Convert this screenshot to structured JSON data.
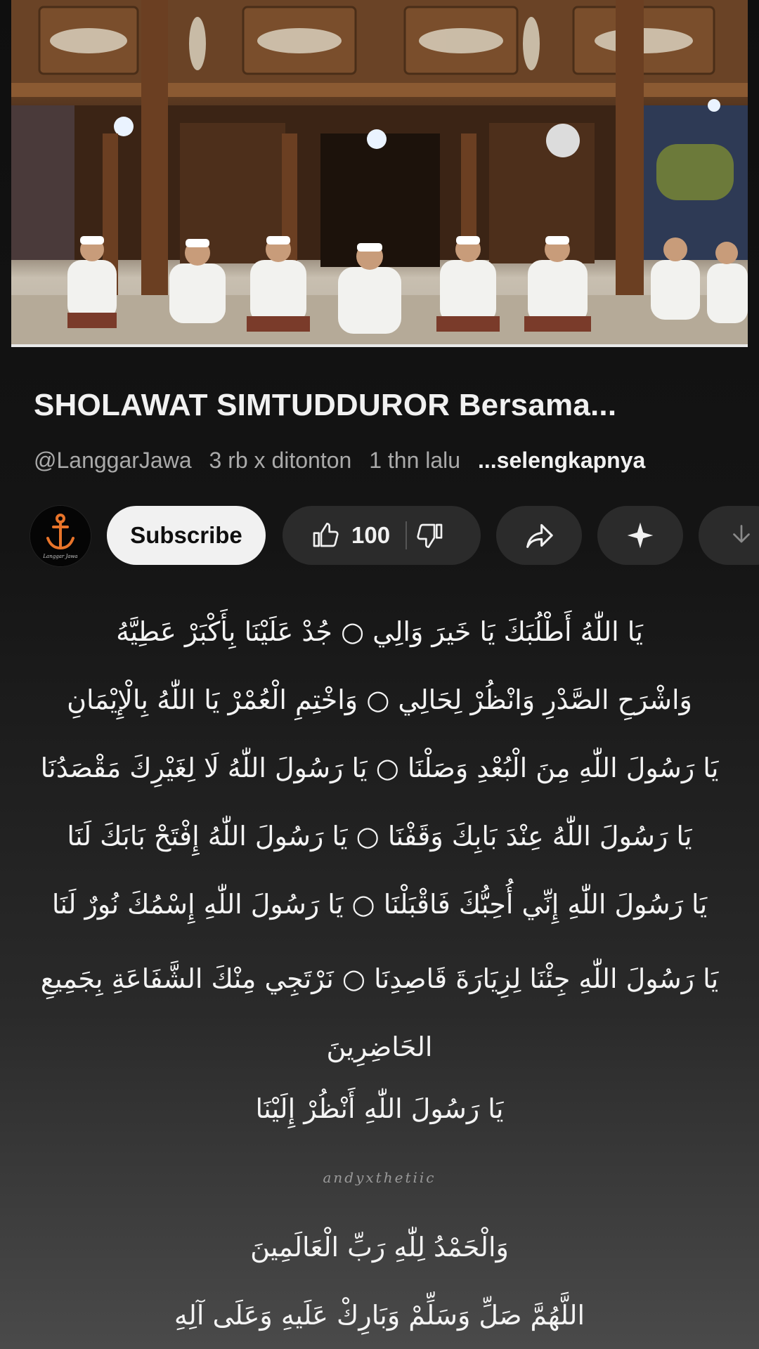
{
  "video": {
    "channel_logo_text": "LanggarJawa"
  },
  "title": "SHOLAWAT SIMTUDDUROR Bersama...",
  "meta": {
    "channel": "@LanggarJawa",
    "views": "3 rb x ditonton",
    "age": "1 thn lalu",
    "more": "...selengkapnya"
  },
  "actions": {
    "avatar_text": "Langgar Jawa",
    "subscribe_label": "Subscribe",
    "like_count": "100"
  },
  "lyrics": [
    "يَا اللّٰهُ أَطْلُبَكَ يَا خَيرَ وَالِي ○ جُدْ عَلَيْنَا بِأَكْبَرْ عَطِيَّهُ",
    "وَاشْرَحِ الصَّدْرِ وَانْظُرْ لِحَالِي ○ وَاخْتِمِ الْعُمْرْ يَا اللّٰهُ بِالْإِيْمَانِ",
    "يَا رَسُولَ اللّٰهِ مِنَ الْبُعْدِ وَصَلْنَا ○ يَا رَسُولَ اللّٰهُ لَا لِغَيْرِكَ مَقْصَدُنَا",
    "يَا رَسُولَ اللّٰهُ عِنْدَ بَابِكَ وَقَفْنَا ○ يَا رَسُولَ اللّٰهُ إِفْتَحْ بَابَكَ لَنَا",
    "يَا رَسُولَ اللّٰهِ إِنِّي أُحِبُّكَ فَاقْبَلْنَا ○ يَا رَسُولَ اللّٰهِ إِسْمُكَ نُورٌ لَنَا",
    "يَا رَسُولَ اللّٰهِ جِئْنَا لِزِيَارَةَ قَاصِدِنَا ○ نَرْتَجِي مِنْكَ الشَّفَاعَةِ بِجَمِيعِ الحَاضِرِينَ",
    "يَا رَسُولَ اللّٰهِ أَنْظُرْ إِلَيْنَا"
  ],
  "watermark": "andyxthetiic",
  "closing": [
    "وَالْحَمْدُ لِلّٰهِ رَبِّ الْعَالَمِينَ",
    "اللَّهُمَّ صَلِّ وَسَلِّمْ وَبَارِكْ عَلَيهِ وَعَلَى آلِهِ"
  ],
  "icons": {
    "like": "thumb-up-icon",
    "dislike": "thumb-down-icon",
    "share": "share-icon",
    "remix": "sparkle-icon",
    "download": "download-icon"
  },
  "colors": {
    "background": "#0f0f0f",
    "subscribe_bg": "#f1f1f1",
    "pill_bg": "#2b2b2b",
    "meta_text": "#aaaaaa"
  }
}
